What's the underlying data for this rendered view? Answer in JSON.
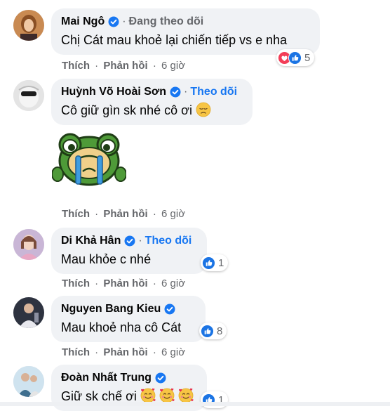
{
  "comments": [
    {
      "name": "Mai Ngô",
      "follow_status": "Đang theo dõi",
      "text": "Chị Cát mau khoẻ lại chiến tiếp vs e nha",
      "actions": {
        "like": "Thích",
        "reply": "Phản hồi",
        "time": "6 giờ"
      },
      "reaction_count": "5",
      "reaction_icons": [
        "heart-icon",
        "like-icon"
      ]
    },
    {
      "name": "Huỳnh Võ Hoài Sơn",
      "follow_link": "Theo dõi",
      "text": "Cô giữ gìn sk nhé cô ơi",
      "emoji": "sad-face-emoji",
      "sticker": "crying-frog-sticker",
      "actions": {
        "like": "Thích",
        "reply": "Phản hồi",
        "time": "6 giờ"
      }
    },
    {
      "name": "Di Khả Hân",
      "follow_link": "Theo dõi",
      "text": "Mau khỏe c nhé",
      "actions": {
        "like": "Thích",
        "reply": "Phản hồi",
        "time": "6 giờ"
      },
      "reaction_count": "1",
      "reaction_icons": [
        "like-icon"
      ]
    },
    {
      "name": "Nguyen Bang Kieu",
      "text": "Mau khoẻ nha cô Cát",
      "actions": {
        "like": "Thích",
        "reply": "Phản hồi",
        "time": "6 giờ"
      },
      "reaction_count": "8",
      "reaction_icons": [
        "like-icon"
      ]
    },
    {
      "name": "Đoàn Nhất Trung",
      "text": "Giữ sk chế ơi",
      "emoji": "smiling-face-with-hearts-emoji",
      "reaction_count": "1",
      "reaction_icons": [
        "like-icon"
      ]
    }
  ],
  "separator": "·",
  "colors": {
    "bubble": "#f0f2f5",
    "link_blue": "#1877f2",
    "meta_gray": "#65676b",
    "text": "#050505"
  }
}
